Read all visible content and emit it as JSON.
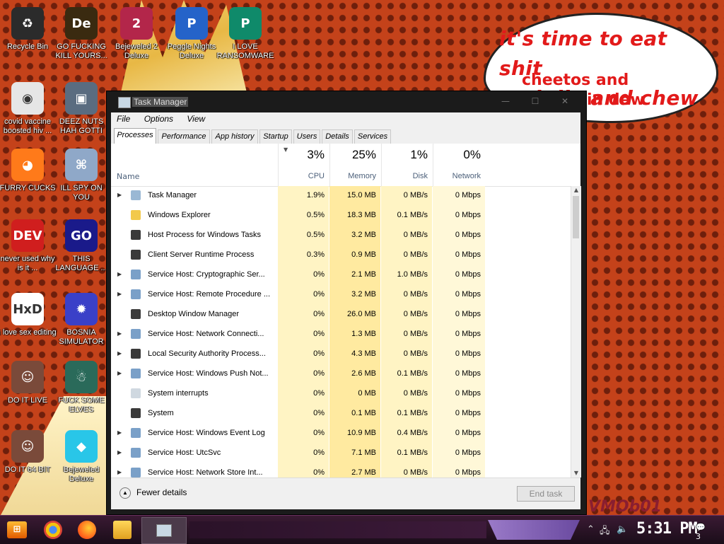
{
  "wallpaper": {
    "bubble_line1": "it's time to eat shit",
    "bubble_line2": "and die and chew",
    "bubble_line3": "cheetos and",
    "bubble_line4": "in dew",
    "watermark": "VMOb01"
  },
  "desktop_icons": [
    {
      "label": "Recycle Bin",
      "icon": "recycle-bin-icon",
      "color": "#2b2b2b"
    },
    {
      "label": "GO FUCKING KILL YOURS...",
      "icon": "dreamweaver-icon",
      "color": "#3a2a10"
    },
    {
      "label": "Bejeweled 2 Deluxe",
      "icon": "bejeweled-icon",
      "color": "#b3264a"
    },
    {
      "label": "Peggle Nights Deluxe",
      "icon": "peggle-icon",
      "color": "#2563c9"
    },
    {
      "label": "I LOVE RANSOMWARE",
      "icon": "publisher-icon",
      "color": "#0f8a6a"
    },
    {
      "label": "covid vaccine boosted hiv ...",
      "icon": "chrome-icon",
      "color": "#e6e6e6"
    },
    {
      "label": "DEEZ NUTS HAH GOTTI",
      "icon": "windows-icon",
      "color": "#5a6c80"
    },
    {
      "label": "FURRY CUCKS",
      "icon": "firefox-icon",
      "color": "#ff7a1a"
    },
    {
      "label": "ILL SPY ON YOU",
      "icon": "network-icon",
      "color": "#8fa8c8"
    },
    {
      "label": "never used why is it ...",
      "icon": "devcpp-icon",
      "color": "#d01e1e"
    },
    {
      "label": "THIS LANGUAGE ...",
      "icon": "goland-icon",
      "color": "#1a1a8a"
    },
    {
      "label": "i love sex editing",
      "icon": "hxd-icon",
      "color": "#ffffff"
    },
    {
      "label": "BOSNIA SIMULATOR",
      "icon": "mine-icon",
      "color": "#3a40c8"
    },
    {
      "label": "DO IT LIVE",
      "icon": "portrait-icon",
      "color": "#7a4a3a"
    },
    {
      "label": "FUCK SOME ELVES",
      "icon": "santa-icon",
      "color": "#2a6a5a"
    },
    {
      "label": "DO IT 64 BIT",
      "icon": "portrait-icon",
      "color": "#7a4a3a"
    },
    {
      "label": "Bejeweled Deluxe",
      "icon": "diamond-icon",
      "color": "#29c6e8"
    }
  ],
  "task_manager": {
    "title": "Task Manager",
    "window_buttons": [
      "—",
      "☐",
      "✕"
    ],
    "menu": [
      "File",
      "Options",
      "View"
    ],
    "tabs": [
      "Processes",
      "Performance",
      "App history",
      "Startup",
      "Users",
      "Details",
      "Services"
    ],
    "columns": {
      "name": "Name",
      "cpu": {
        "pct": "3%",
        "label": "CPU"
      },
      "memory": {
        "pct": "25%",
        "label": "Memory"
      },
      "disk": {
        "pct": "1%",
        "label": "Disk"
      },
      "network": {
        "pct": "0%",
        "label": "Network"
      }
    },
    "processes": [
      {
        "name": "Task Manager",
        "cpu": "1.9%",
        "memory": "15.0 MB",
        "disk": "0 MB/s",
        "network": "0 Mbps",
        "expandable": true
      },
      {
        "name": "Windows Explorer",
        "cpu": "0.5%",
        "memory": "18.3 MB",
        "disk": "0.1 MB/s",
        "network": "0 Mbps",
        "expandable": false
      },
      {
        "name": "Host Process for Windows Tasks",
        "cpu": "0.5%",
        "memory": "3.2 MB",
        "disk": "0 MB/s",
        "network": "0 Mbps",
        "expandable": false
      },
      {
        "name": "Client Server Runtime Process",
        "cpu": "0.3%",
        "memory": "0.9 MB",
        "disk": "0 MB/s",
        "network": "0 Mbps",
        "expandable": false
      },
      {
        "name": "Service Host: Cryptographic Ser...",
        "cpu": "0%",
        "memory": "2.1 MB",
        "disk": "1.0 MB/s",
        "network": "0 Mbps",
        "expandable": true
      },
      {
        "name": "Service Host: Remote Procedure ...",
        "cpu": "0%",
        "memory": "3.2 MB",
        "disk": "0 MB/s",
        "network": "0 Mbps",
        "expandable": true
      },
      {
        "name": "Desktop Window Manager",
        "cpu": "0%",
        "memory": "26.0 MB",
        "disk": "0 MB/s",
        "network": "0 Mbps",
        "expandable": false
      },
      {
        "name": "Service Host: Network Connecti...",
        "cpu": "0%",
        "memory": "1.3 MB",
        "disk": "0 MB/s",
        "network": "0 Mbps",
        "expandable": true
      },
      {
        "name": "Local Security Authority Process...",
        "cpu": "0%",
        "memory": "4.3 MB",
        "disk": "0 MB/s",
        "network": "0 Mbps",
        "expandable": true
      },
      {
        "name": "Service Host: Windows Push Not...",
        "cpu": "0%",
        "memory": "2.6 MB",
        "disk": "0.1 MB/s",
        "network": "0 Mbps",
        "expandable": true
      },
      {
        "name": "System interrupts",
        "cpu": "0%",
        "memory": "0 MB",
        "disk": "0 MB/s",
        "network": "0 Mbps",
        "expandable": false
      },
      {
        "name": "System",
        "cpu": "0%",
        "memory": "0.1 MB",
        "disk": "0.1 MB/s",
        "network": "0 Mbps",
        "expandable": false
      },
      {
        "name": "Service Host: Windows Event Log",
        "cpu": "0%",
        "memory": "10.9 MB",
        "disk": "0.4 MB/s",
        "network": "0 Mbps",
        "expandable": true
      },
      {
        "name": "Service Host: UtcSvc",
        "cpu": "0%",
        "memory": "7.1 MB",
        "disk": "0.1 MB/s",
        "network": "0 Mbps",
        "expandable": true
      },
      {
        "name": "Service Host: Network Store Int...",
        "cpu": "0%",
        "memory": "2.7 MB",
        "disk": "0 MB/s",
        "network": "0 Mbps",
        "expandable": true
      }
    ],
    "footer": {
      "fewer_details": "Fewer details",
      "end_task": "End task"
    }
  },
  "taskbar": {
    "start_label": "⊞",
    "clock": "5:31 PM",
    "notifications": "3"
  },
  "colors": {
    "cpu_col": "#fff4c4",
    "mem_col": "#ffeaa0",
    "disk_col": "#fff4c4",
    "net_col": "#fff8d8"
  }
}
